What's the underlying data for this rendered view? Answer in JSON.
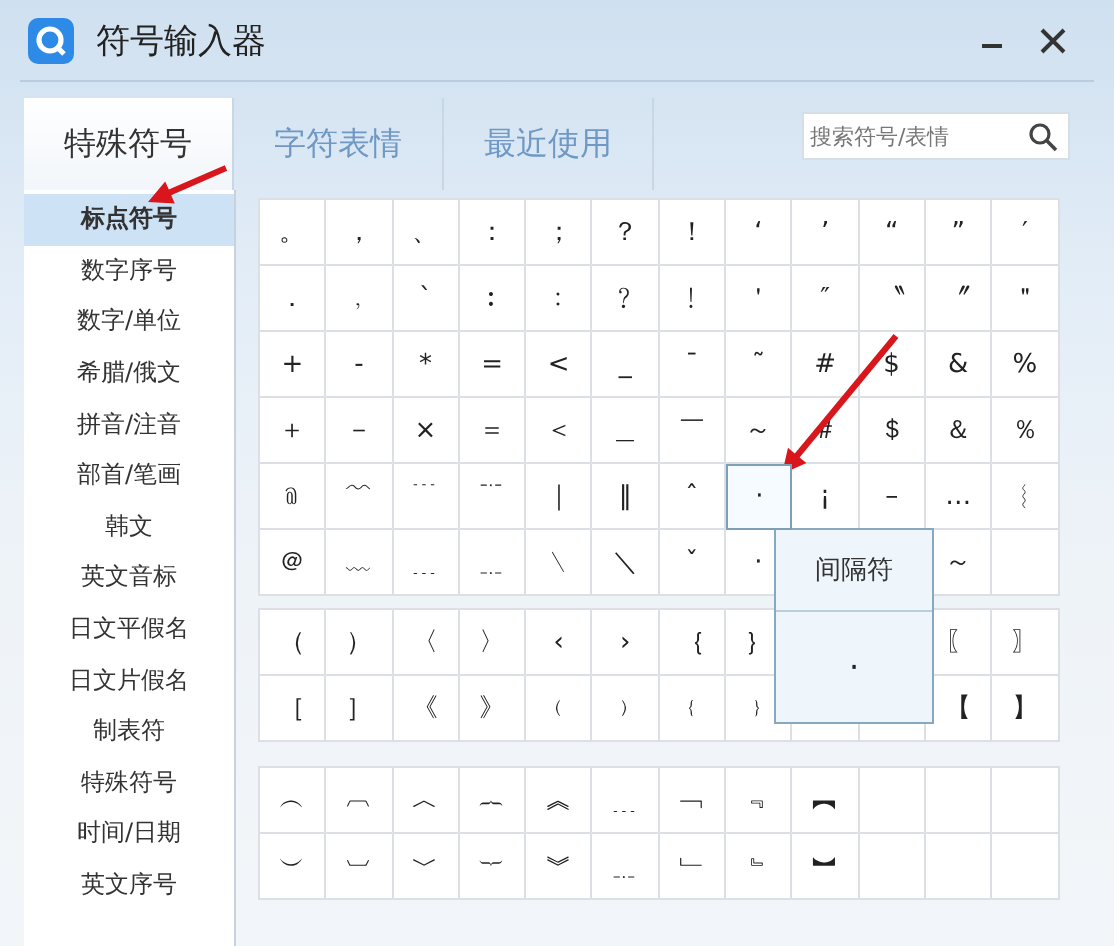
{
  "window": {
    "title": "符号输入器"
  },
  "tabs": [
    {
      "label": "特殊符号",
      "selected": true
    },
    {
      "label": "字符表情",
      "selected": false
    },
    {
      "label": "最近使用",
      "selected": false
    }
  ],
  "search": {
    "placeholder": "搜索符号/表情"
  },
  "sidebar": {
    "items": [
      {
        "label": "标点符号",
        "selected": true
      },
      {
        "label": "数字序号",
        "selected": false
      },
      {
        "label": "数字/单位",
        "selected": false
      },
      {
        "label": "希腊/俄文",
        "selected": false
      },
      {
        "label": "拼音/注音",
        "selected": false
      },
      {
        "label": "部首/笔画",
        "selected": false
      },
      {
        "label": "韩文",
        "selected": false
      },
      {
        "label": "英文音标",
        "selected": false
      },
      {
        "label": "日文平假名",
        "selected": false
      },
      {
        "label": "日文片假名",
        "selected": false
      },
      {
        "label": "制表符",
        "selected": false
      },
      {
        "label": "特殊符号",
        "selected": false
      },
      {
        "label": "时间/日期",
        "selected": false
      },
      {
        "label": "英文序号",
        "selected": false
      }
    ]
  },
  "grids": [
    {
      "rows": [
        {
          "cells": [
            {
              "symbol": "。",
              "hovered": false
            },
            {
              "symbol": "，",
              "hovered": false
            },
            {
              "symbol": "、",
              "hovered": false
            },
            {
              "symbol": "：",
              "hovered": false
            },
            {
              "symbol": "；",
              "hovered": false
            },
            {
              "symbol": "？",
              "hovered": false
            },
            {
              "symbol": "！",
              "hovered": false
            },
            {
              "symbol": "‘",
              "hovered": false
            },
            {
              "symbol": "’",
              "hovered": false
            },
            {
              "symbol": "“",
              "hovered": false
            },
            {
              "symbol": "”",
              "hovered": false
            },
            {
              "symbol": "′",
              "hovered": false
            }
          ]
        },
        {
          "cells": [
            {
              "symbol": "．",
              "hovered": false
            },
            {
              "symbol": "﹐",
              "hovered": false
            },
            {
              "symbol": "ˋ",
              "hovered": false
            },
            {
              "symbol": "︰",
              "hovered": false
            },
            {
              "symbol": "﹕",
              "hovered": false
            },
            {
              "symbol": "﹖",
              "hovered": false
            },
            {
              "symbol": "﹗",
              "hovered": false
            },
            {
              "symbol": "＇",
              "hovered": false
            },
            {
              "symbol": "″",
              "hovered": false
            },
            {
              "symbol": "〝",
              "hovered": false
            },
            {
              "symbol": "〞",
              "hovered": false
            },
            {
              "symbol": "＂",
              "hovered": false
            }
          ]
        },
        {
          "cells": [
            {
              "symbol": "+",
              "hovered": false
            },
            {
              "symbol": "-",
              "hovered": false
            },
            {
              "symbol": "*",
              "hovered": false
            },
            {
              "symbol": "=",
              "hovered": false
            },
            {
              "symbol": "<",
              "hovered": false
            },
            {
              "symbol": "_",
              "hovered": false
            },
            {
              "symbol": "¯",
              "hovered": false
            },
            {
              "symbol": "˜",
              "hovered": false
            },
            {
              "symbol": "#",
              "hovered": false
            },
            {
              "symbol": "$",
              "hovered": false
            },
            {
              "symbol": "&",
              "hovered": false
            },
            {
              "symbol": "%",
              "hovered": false
            }
          ]
        },
        {
          "cells": [
            {
              "symbol": "＋",
              "hovered": false
            },
            {
              "symbol": "－",
              "hovered": false
            },
            {
              "symbol": "×",
              "hovered": false
            },
            {
              "symbol": "＝",
              "hovered": false
            },
            {
              "symbol": "＜",
              "hovered": false
            },
            {
              "symbol": "＿",
              "hovered": false
            },
            {
              "symbol": "￣",
              "hovered": false
            },
            {
              "symbol": "～",
              "hovered": false
            },
            {
              "symbol": "＃",
              "hovered": false
            },
            {
              "symbol": "＄",
              "hovered": false
            },
            {
              "symbol": "＆",
              "hovered": false
            },
            {
              "symbol": "％",
              "hovered": false
            }
          ]
        },
        {
          "cells": [
            {
              "symbol": "﹫",
              "hovered": false
            },
            {
              "symbol": "﹌",
              "hovered": false
            },
            {
              "symbol": "﹉",
              "hovered": false
            },
            {
              "symbol": "﹊",
              "hovered": false
            },
            {
              "symbol": "｜",
              "hovered": false
            },
            {
              "symbol": "‖",
              "hovered": false
            },
            {
              "symbol": "ˆ",
              "hovered": false
            },
            {
              "symbol": "·",
              "hovered": true
            },
            {
              "symbol": "¡",
              "hovered": false
            },
            {
              "symbol": "–",
              "hovered": false
            },
            {
              "symbol": "…",
              "hovered": false
            },
            {
              "symbol": "︴",
              "hovered": false
            }
          ]
        },
        {
          "cells": [
            {
              "symbol": "＠",
              "hovered": false
            },
            {
              "symbol": "﹏",
              "hovered": false
            },
            {
              "symbol": "﹍",
              "hovered": false
            },
            {
              "symbol": "﹎",
              "hovered": false
            },
            {
              "symbol": "﹨",
              "hovered": false
            },
            {
              "symbol": "＼",
              "hovered": false
            },
            {
              "symbol": "ˇ",
              "hovered": false
            },
            {
              "symbol": "·",
              "hovered": false
            },
            null,
            null,
            {
              "symbol": "～",
              "hovered": false
            },
            {
              "hovered": false
            }
          ]
        }
      ]
    },
    {
      "rows": [
        {
          "cells": [
            {
              "symbol": "（",
              "hovered": false
            },
            {
              "symbol": "）",
              "hovered": false
            },
            {
              "symbol": "〈",
              "hovered": false
            },
            {
              "symbol": "〉",
              "hovered": false
            },
            {
              "symbol": "‹",
              "hovered": false
            },
            {
              "symbol": "›",
              "hovered": false
            },
            {
              "symbol": "｛",
              "hovered": false
            },
            {
              "symbol": "｝",
              "hovered": false
            },
            null,
            null,
            {
              "symbol": "〖",
              "hovered": false
            },
            {
              "symbol": "〗",
              "hovered": false
            }
          ]
        },
        {
          "cells": [
            {
              "symbol": "［",
              "hovered": false
            },
            {
              "symbol": "］",
              "hovered": false
            },
            {
              "symbol": "《",
              "hovered": false
            },
            {
              "symbol": "》",
              "hovered": false
            },
            {
              "symbol": "﹙",
              "hovered": false
            },
            {
              "symbol": "﹚",
              "hovered": false
            },
            {
              "symbol": "﹛",
              "hovered": false
            },
            {
              "symbol": "﹜",
              "hovered": false
            },
            {
              "hovered": false
            },
            {
              "hovered": false
            },
            {
              "symbol": "【",
              "hovered": false
            },
            {
              "symbol": "】",
              "hovered": false
            }
          ]
        }
      ]
    },
    {
      "rows": [
        {
          "cells": [
            {
              "symbol": "︵",
              "hovered": false
            },
            {
              "symbol": "︹",
              "hovered": false
            },
            {
              "symbol": "︿",
              "hovered": false
            },
            {
              "symbol": "︷",
              "hovered": false
            },
            {
              "symbol": "︽",
              "hovered": false
            },
            {
              "symbol": "﹍",
              "hovered": false
            },
            {
              "symbol": "﹁",
              "hovered": false
            },
            {
              "symbol": "﹃",
              "hovered": false
            },
            {
              "symbol": "︻",
              "hovered": false
            },
            {
              "hovered": false
            },
            {
              "hovered": false
            },
            {
              "hovered": false
            }
          ]
        },
        {
          "cells": [
            {
              "symbol": "︶",
              "hovered": false
            },
            {
              "symbol": "︺",
              "hovered": false
            },
            {
              "symbol": "﹀",
              "hovered": false
            },
            {
              "symbol": "︸",
              "hovered": false
            },
            {
              "symbol": "︾",
              "hovered": false
            },
            {
              "symbol": "﹎",
              "hovered": false
            },
            {
              "symbol": "﹂",
              "hovered": false
            },
            {
              "symbol": "﹄",
              "hovered": false
            },
            {
              "symbol": "︼",
              "hovered": false
            },
            {
              "hovered": false
            },
            {
              "hovered": false
            },
            {
              "hovered": false
            }
          ]
        }
      ]
    }
  ],
  "tooltip": {
    "title": "间隔符",
    "preview": "·"
  }
}
